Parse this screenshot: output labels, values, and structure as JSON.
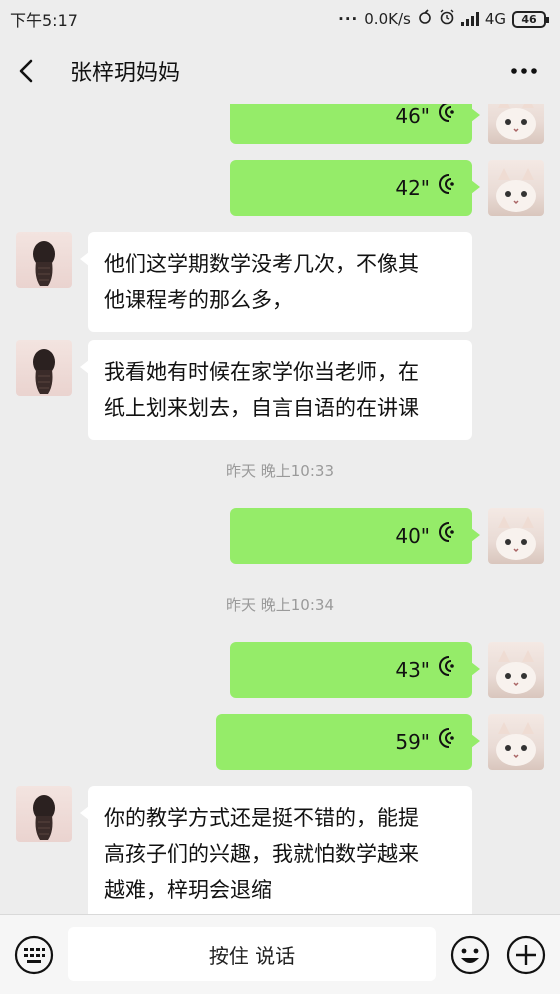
{
  "status_bar": {
    "time": "下午5:17",
    "speed": "0.0K/s",
    "network": "4G",
    "battery": "46"
  },
  "header": {
    "title": "张梓玥妈妈"
  },
  "messages": [
    {
      "type": "voice",
      "direction": "out",
      "duration": "46\""
    },
    {
      "type": "voice",
      "direction": "out",
      "duration": "42\""
    },
    {
      "type": "text",
      "direction": "in",
      "lines": [
        "他们这学期数学没考几次，不像其",
        "他课程考的那么多，"
      ]
    },
    {
      "type": "text",
      "direction": "in",
      "lines": [
        "我看她有时候在家学你当老师，在",
        "纸上划来划去，自言自语的在讲课"
      ]
    },
    {
      "type": "time",
      "text": "昨天 晚上10:33"
    },
    {
      "type": "voice",
      "direction": "out",
      "duration": "40\""
    },
    {
      "type": "time",
      "text": "昨天 晚上10:34"
    },
    {
      "type": "voice",
      "direction": "out",
      "duration": "43\""
    },
    {
      "type": "voice",
      "direction": "out",
      "duration": "59\""
    },
    {
      "type": "text",
      "direction": "in",
      "lines": [
        "你的教学方式还是挺不错的，能提",
        "高孩子们的兴趣，我就怕数学越来",
        "越难，梓玥会退缩"
      ]
    }
  ],
  "input_bar": {
    "hold_to_talk_label": "按住 说话"
  },
  "colors": {
    "outgoing_bubble": "#95ec69",
    "incoming_bubble": "#ffffff",
    "background": "#ededed"
  },
  "icons": [
    "back-icon",
    "more-icon",
    "voice-wave-icon",
    "keyboard-icon",
    "emoji-icon",
    "plus-icon"
  ]
}
